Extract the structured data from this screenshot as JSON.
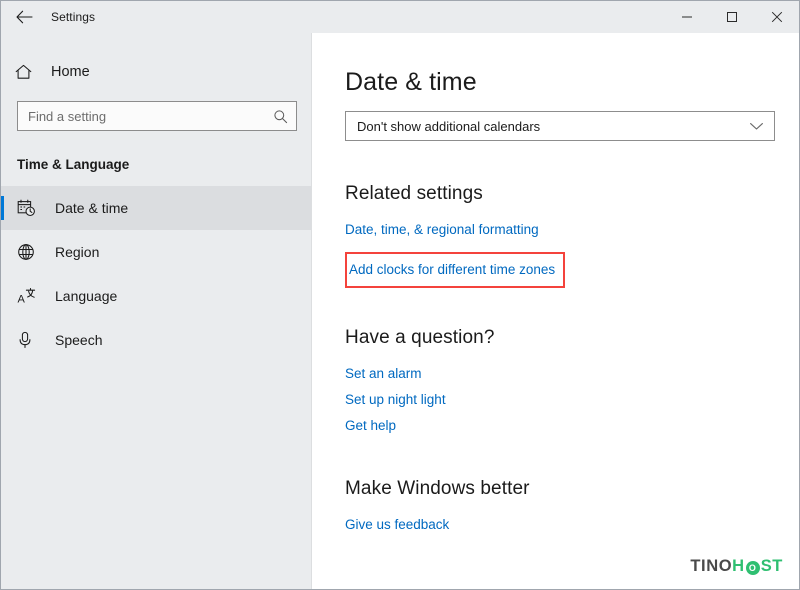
{
  "window": {
    "app_title": "Settings",
    "back_icon": "back-arrow-icon",
    "controls": {
      "minimize": "minimize-icon",
      "maximize": "maximize-icon",
      "close": "close-icon"
    }
  },
  "sidebar": {
    "home": {
      "label": "Home",
      "icon": "home-icon"
    },
    "search": {
      "placeholder": "Find a setting",
      "value": "",
      "icon": "search-icon"
    },
    "group_title": "Time & Language",
    "items": [
      {
        "label": "Date & time",
        "icon": "calendar-clock-icon",
        "active": true
      },
      {
        "label": "Region",
        "icon": "globe-icon",
        "active": false
      },
      {
        "label": "Language",
        "icon": "language-icon",
        "active": false
      },
      {
        "label": "Speech",
        "icon": "microphone-icon",
        "active": false
      }
    ]
  },
  "content": {
    "page_title": "Date & time",
    "calendar_dropdown": {
      "value": "Don't show additional calendars",
      "icon": "chevron-down-icon"
    },
    "related": {
      "heading": "Related settings",
      "links": [
        "Date, time, & regional formatting",
        "Add clocks for different time zones"
      ]
    },
    "question": {
      "heading": "Have a question?",
      "links": [
        "Set an alarm",
        "Set up night light",
        "Get help"
      ]
    },
    "better": {
      "heading": "Make Windows better",
      "link": "Give us feedback"
    }
  },
  "watermark": {
    "part1": "TINO",
    "part2": "H",
    "part3": "O",
    "part4": "ST"
  },
  "colors": {
    "accent": "#0078d7",
    "link": "#0069c0",
    "highlight_box": "#f4433c",
    "sidebar_bg": "#eaecee",
    "watermark_green": "#2fbf71"
  }
}
